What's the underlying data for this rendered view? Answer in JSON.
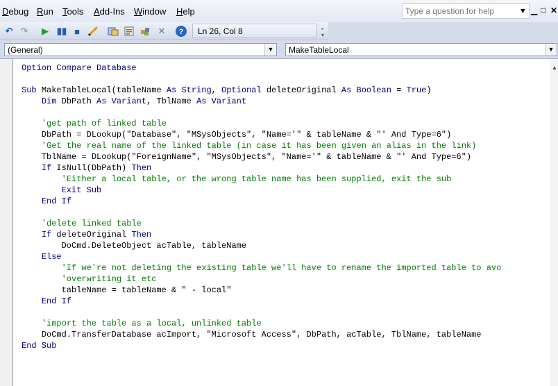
{
  "menubar": {
    "items": [
      "Debug",
      "Run",
      "Tools",
      "Add-Ins",
      "Window",
      "Help"
    ],
    "underline": [
      "D",
      "R",
      "T",
      "A",
      "W",
      "H"
    ],
    "ask_placeholder": "Type a question for help",
    "window_controls": [
      "▾",
      "▁",
      "□",
      "✕"
    ]
  },
  "toolbar": {
    "icons": [
      "undo-icon",
      "redo-icon",
      "run-icon",
      "break-icon",
      "reset-icon",
      "design-mode-icon",
      "project-explorer-icon",
      "properties-window-icon",
      "object-browser-icon",
      "toolbox-icon",
      "help-icon"
    ],
    "position": "Ln 26, Col 8"
  },
  "combos": {
    "object": "(General)",
    "procedure": "MakeTableLocal"
  },
  "colors": {
    "keyword": "#00007f",
    "comment": "#008000",
    "text": "#000000"
  },
  "code": {
    "lines": [
      [
        {
          "k": "Option Compare Database"
        }
      ],
      [],
      [
        {
          "k": "Sub "
        },
        {
          "t": "MakeTableLocal(tableName "
        },
        {
          "k": "As String"
        },
        {
          "t": ", "
        },
        {
          "k": "Optional"
        },
        {
          "t": " deleteOriginal "
        },
        {
          "k": "As Boolean"
        },
        {
          "t": " = "
        },
        {
          "k": "True"
        },
        {
          "t": ")"
        }
      ],
      [
        {
          "t": "    "
        },
        {
          "k": "Dim"
        },
        {
          "t": " DbPath "
        },
        {
          "k": "As Variant"
        },
        {
          "t": ", TblName "
        },
        {
          "k": "As Variant"
        }
      ],
      [],
      [
        {
          "t": "    "
        },
        {
          "c": "'get path of linked table"
        }
      ],
      [
        {
          "t": "    DbPath = DLookup(\"Database\", \"MSysObjects\", \"Name='\" & tableName & \"' And Type=6\")"
        }
      ],
      [
        {
          "t": "    "
        },
        {
          "c": "'Get the real name of the linked table (in case it has been given an alias in the link)"
        }
      ],
      [
        {
          "t": "    TblName = DLookup(\"ForeignName\", \"MSysObjects\", \"Name='\" & tableName & \"' And Type=6\")"
        }
      ],
      [
        {
          "t": "    "
        },
        {
          "k": "If"
        },
        {
          "t": " IsNull(DbPath) "
        },
        {
          "k": "Then"
        }
      ],
      [
        {
          "t": "        "
        },
        {
          "c": "'Either a local table, or the wrong table name has been supplied, exit the sub"
        }
      ],
      [
        {
          "t": "        "
        },
        {
          "k": "Exit Sub"
        }
      ],
      [
        {
          "t": "    "
        },
        {
          "k": "End If"
        }
      ],
      [],
      [
        {
          "t": "    "
        },
        {
          "c": "'delete linked table"
        }
      ],
      [
        {
          "t": "    "
        },
        {
          "k": "If"
        },
        {
          "t": " deleteOriginal "
        },
        {
          "k": "Then"
        }
      ],
      [
        {
          "t": "        DoCmd.DeleteObject acTable, tableName"
        }
      ],
      [
        {
          "t": "    "
        },
        {
          "k": "Else"
        }
      ],
      [
        {
          "t": "        "
        },
        {
          "c": "'If we're not deleting the existing table we'll have to rename the imported table to avo"
        }
      ],
      [
        {
          "t": "        "
        },
        {
          "c": "'overwriting it etc"
        }
      ],
      [
        {
          "t": "        tableName = tableName & \" - local\""
        }
      ],
      [
        {
          "t": "    "
        },
        {
          "k": "End If"
        }
      ],
      [],
      [
        {
          "t": "    "
        },
        {
          "c": "'import the table as a local, unlinked table"
        }
      ],
      [
        {
          "t": "    DoCmd.TransferDatabase acImport, \"Microsoft Access\", DbPath, acTable, TblName, tableName"
        }
      ],
      [
        {
          "k": "End Sub"
        }
      ]
    ]
  }
}
